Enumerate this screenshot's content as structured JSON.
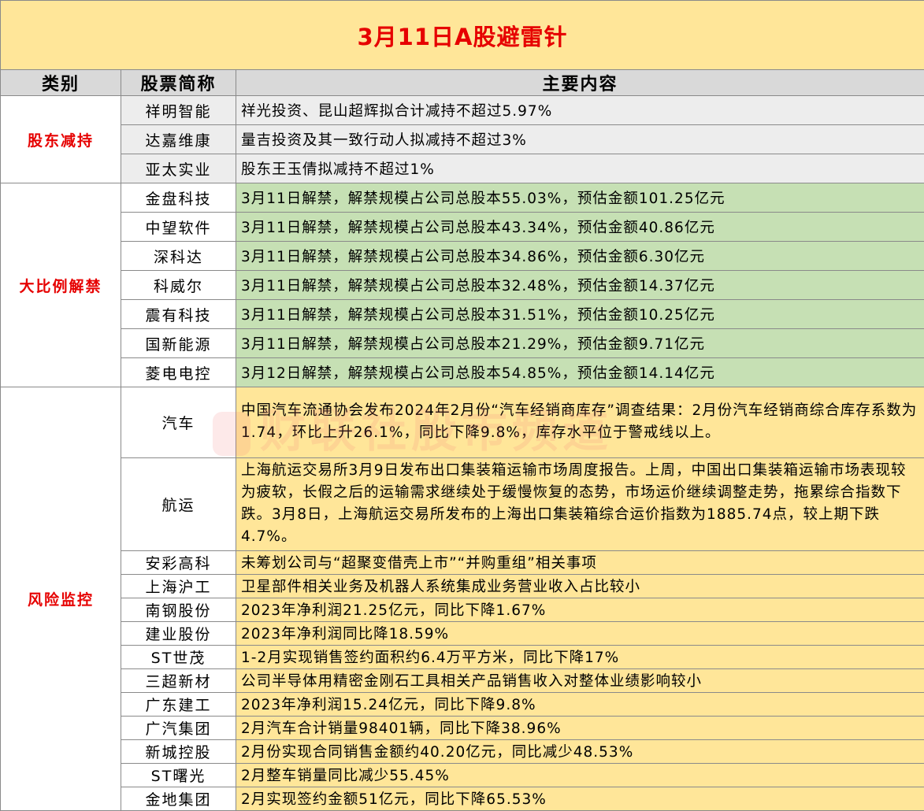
{
  "title": "3月11日A股避雷针",
  "headers": {
    "category": "类别",
    "stock": "股票简称",
    "content": "主要内容"
  },
  "watermark": "财联社股市频道",
  "groups": [
    {
      "category": "股东减持",
      "rows": [
        {
          "stock": "祥明智能",
          "content": "祥光投资、昆山超辉拟合计减持不超过5.97%"
        },
        {
          "stock": "达嘉维康",
          "content": "量吉投资及其一致行动人拟减持不超过3%"
        },
        {
          "stock": "亚太实业",
          "content": "股东王玉倩拟减持不超过1%"
        }
      ]
    },
    {
      "category": "大比例解禁",
      "rows": [
        {
          "stock": "金盘科技",
          "content": "3月11日解禁，解禁规模占公司总股本55.03%，预估金额101.25亿元"
        },
        {
          "stock": "中望软件",
          "content": "3月11日解禁，解禁规模占公司总股本43.34%，预估金额40.86亿元"
        },
        {
          "stock": "深科达",
          "content": "3月11日解禁，解禁规模占公司总股本34.86%，预估金额6.30亿元"
        },
        {
          "stock": "科威尔",
          "content": "3月11日解禁，解禁规模占公司总股本32.48%，预估金额14.37亿元"
        },
        {
          "stock": "震有科技",
          "content": "3月11日解禁，解禁规模占公司总股本31.51%，预估金额10.25亿元"
        },
        {
          "stock": "国新能源",
          "content": "3月11日解禁，解禁规模占公司总股本21.29%，预估金额9.71亿元"
        },
        {
          "stock": "菱电电控",
          "content": "3月12日解禁，解禁规模占公司总股本54.85%，预估金额14.14亿元"
        }
      ]
    },
    {
      "category": "风险监控",
      "rows": [
        {
          "stock": "汽车",
          "content": "中国汽车流通协会发布2024年2月份“汽车经销商库存”调查结果：2月份汽车经销商综合库存系数为1.74，环比上升26.1%，同比下降9.8%，库存水平位于警戒线以上。"
        },
        {
          "stock": "航运",
          "content": "上海航运交易所3月9日发布出口集装箱运输市场周度报告。上周，中国出口集装箱运输市场表现较为疲软，长假之后的运输需求继续处于缓慢恢复的态势，市场运价继续调整走势，拖累综合指数下跌。3月8日，上海航运交易所发布的上海出口集装箱综合运价指数为1885.74点，较上期下跌4.7%。"
        },
        {
          "stock": "安彩高科",
          "content": "未筹划公司与“超聚变借壳上市”“并购重组”相关事项"
        },
        {
          "stock": "上海沪工",
          "content": "卫星部件相关业务及机器人系统集成业务营业收入占比较小"
        },
        {
          "stock": "南钢股份",
          "content": "2023年净利润21.25亿元，同比下降1.67%"
        },
        {
          "stock": "建业股份",
          "content": "2023年净利润同比降18.59%"
        },
        {
          "stock": "ST世茂",
          "content": "1-2月实现销售签约面积约6.4万平方米，同比下降17%"
        },
        {
          "stock": "三超新材",
          "content": "公司半导体用精密金刚石工具相关产品销售收入对整体业绩影响较小"
        },
        {
          "stock": "广东建工",
          "content": "2023年净利润15.24亿元，同比下降9.8%"
        },
        {
          "stock": "广汽集团",
          "content": "2月汽车合计销量98401辆，同比下降38.96%"
        },
        {
          "stock": "新城控股",
          "content": "2月份实现合同销售金额约40.20亿元，同比减少48.53%"
        },
        {
          "stock": "ST曙光",
          "content": "2月整车销量同比减少55.45%"
        },
        {
          "stock": "金地集团",
          "content": "2月实现签约金额51亿元，同比下降65.53%"
        }
      ]
    }
  ]
}
